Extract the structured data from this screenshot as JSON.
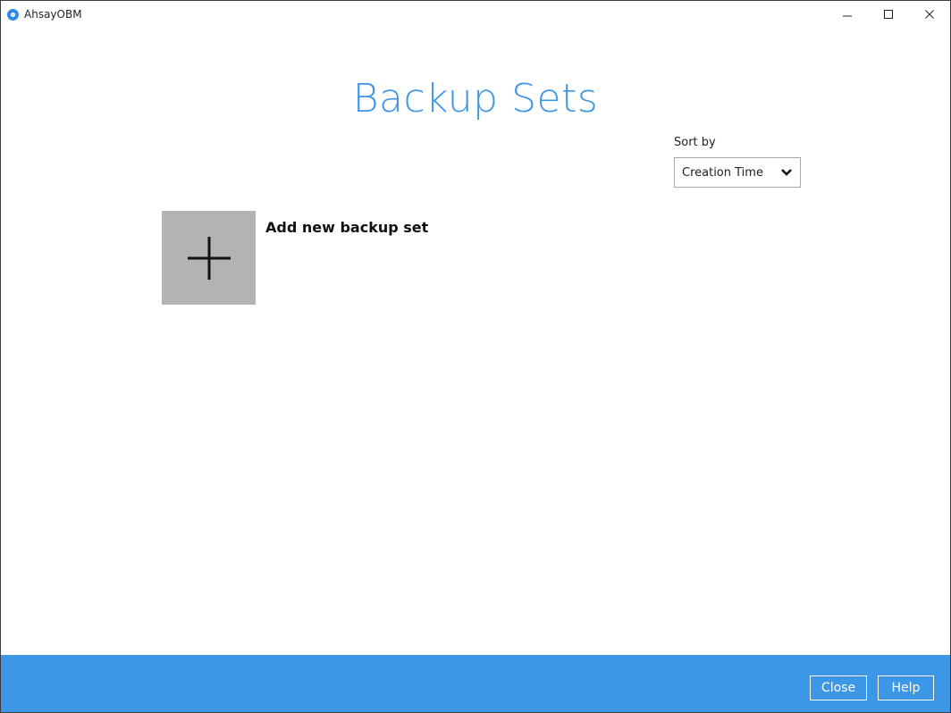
{
  "window": {
    "title": "AhsayOBM",
    "controls": [
      "minimize-icon",
      "maximize-icon",
      "close-icon"
    ]
  },
  "page": {
    "title": "Backup Sets"
  },
  "sort": {
    "label": "Sort by",
    "selected": "Creation Time",
    "icon": "chevron-down-icon"
  },
  "add_backup": {
    "icon": "plus-icon",
    "label": "Add new backup set"
  },
  "footer": {
    "close_label": "Close",
    "help_label": "Help"
  },
  "colors": {
    "accent": "#3c97e6",
    "title": "#3e95e6",
    "tile": "#b3b3b3"
  }
}
